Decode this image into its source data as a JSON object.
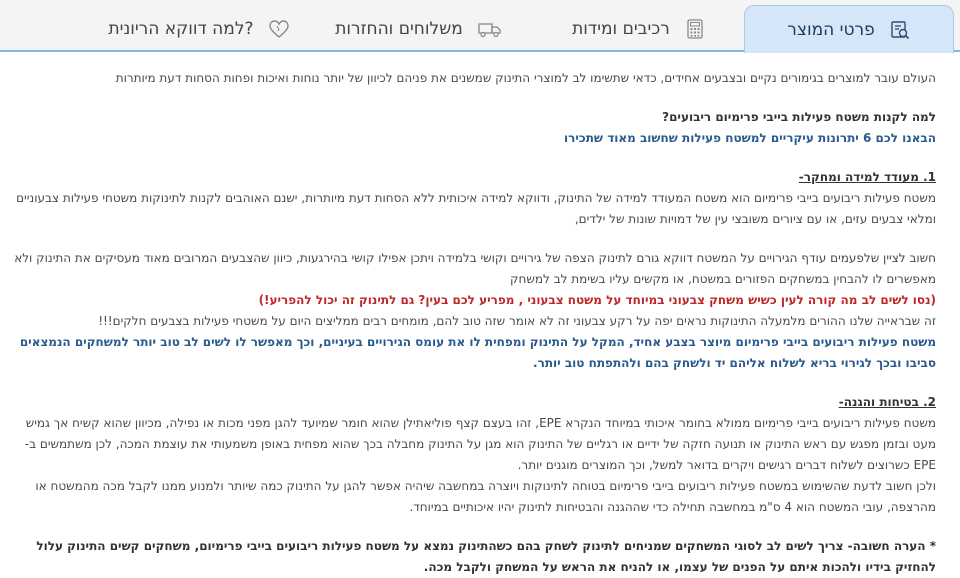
{
  "tabs": [
    {
      "label": "פרטי המוצר",
      "icon": "product-search-icon",
      "active": true
    },
    {
      "label": "רכיבים ומידות",
      "icon": "calculator-icon",
      "active": false
    },
    {
      "label": "משלוחים והחזרות",
      "icon": "truck-icon",
      "active": false
    },
    {
      "label": "למה דווקא הריונית?",
      "icon": "heart-icon",
      "active": false
    }
  ],
  "content": {
    "intro": "העולם עובר למוצרים בגימורים נקיים ובצבעים אחידים, כדאי שתשימו לב למוצרי התינוק שמשנים את פניהם לכיוון של יותר נוחות ואיכות ופחות הסחות דעת מיותרות",
    "q_title": "למה לקנות משטח פעילות בייבי פרימיום ריבועים?",
    "q_subtitle": "הבאנו לכם 6 יתרונות עיקריים למשטח פעילות שחשוב מאוד שתכירו",
    "s1_title": "1. מעודד למידה ומחקר-",
    "s1_p1": "משטח פעילות ריבועים בייבי פרימיום הוא משטח המעודד למידה של התינוק, ודווקא למידה איכותית ללא הסחות דעת מיותרות, ישנם האוהבים לקנות לתינוקות משטחי פעילות צבעוניים ומלאי צבעים עזים, או עם ציורים משובצי עין של דמויות שונות של ילדים,",
    "s1_p2": "חשוב לציין שלפעמים עודף הגירויים על המשטח דווקא גורם לתינוק הצפה של גירויים וקושי בלמידה ויתכן אפילו קושי בהירגעות, כיוון שהצבעים המרובים מאוד מעסיקים את התינוק ולא מאפשרים לו להבחין במשחקים הפזורים במשטח, או מקשים עליו בשימת לב למשחק",
    "s1_red": "(נסו לשים לב מה קורה לעין כשיש משחק צבעוני במיוחד על משטח צבעוני , מפריע לכם בעין? גם לתינוק זה יכול להפריע!)",
    "s1_p3": "זה שבראייה שלנו ההורים מלמעלה התינוקות נראים יפה על רקע צבעוני זה לא אומר שזה טוב להם, מומחים רבים ממליצים היום על משטחי פעילות בצבעים חלקים!!!",
    "s1_blue": "משטח פעילות ריבועים בייבי פרימיום מיוצר בצבע אחיד, המקל על התינוק ומפחית לו את עומס הגירויים בעיניים, וכך מאפשר לו לשים לב טוב יותר למשחקים הנמצאים סביבו ובכך לגירוי בריא לשלוח אליהם יד ולשחק בהם ולהתפתח טוב יותר.",
    "s2_title": "2. בטיחות והגנה-",
    "s2_p1": "משטח פעילות ריבועים בייבי פרימיום ממולא בחומר איכותי במיוחד הנקרא EPE, זהו בעצם קצף פוליאתילן שהוא חומר שמיועד להגן מפני מכות או נפילה, מכיוון שהוא קשיח אך גמיש מעט ובזמן מפגש עם ראש התינוק או תנועה חזקה של ידיים או רגליים של התינוק הוא מגן על התינוק מחבלה בכך שהוא מפחית באופן משמעותי את עוצמת המכה, לכן משתמשים ב-EPE כשרוצים לשלוח דברים רגישים ויקרים בדואר למשל, וכך המוצרים מוגנים יותר.",
    "s2_p2": "ולכן חשוב לדעת שהשימוש במשטח פעילות ריבועים בייבי פרימיום בטוחה לתינוקות ויוצרה במחשבה שיהיה אפשר להגן על התינוק כמה שיותר ולמנוע ממנו לקבל מכה מהמשטח או מהרצפה, עובי המשטח הוא 4 ס\"מ במחשבה תחילה כדי שההגנה והבטיחות לתינוק יהיו איכותיים במיוחד.",
    "note": "* הערה חשובה- צריך לשים לב לסוגי המשחקים שמניחים לתינוק לשחק בהם כשהתינוק נמצא על משטח פעילות ריבועים בייבי פרימיום, משחקים קשים התינוק עלול להחזיק בידיו ולהכות איתם על הפנים של עצמו, או להניח את הראש על המשחק ולקבל מכה."
  }
}
